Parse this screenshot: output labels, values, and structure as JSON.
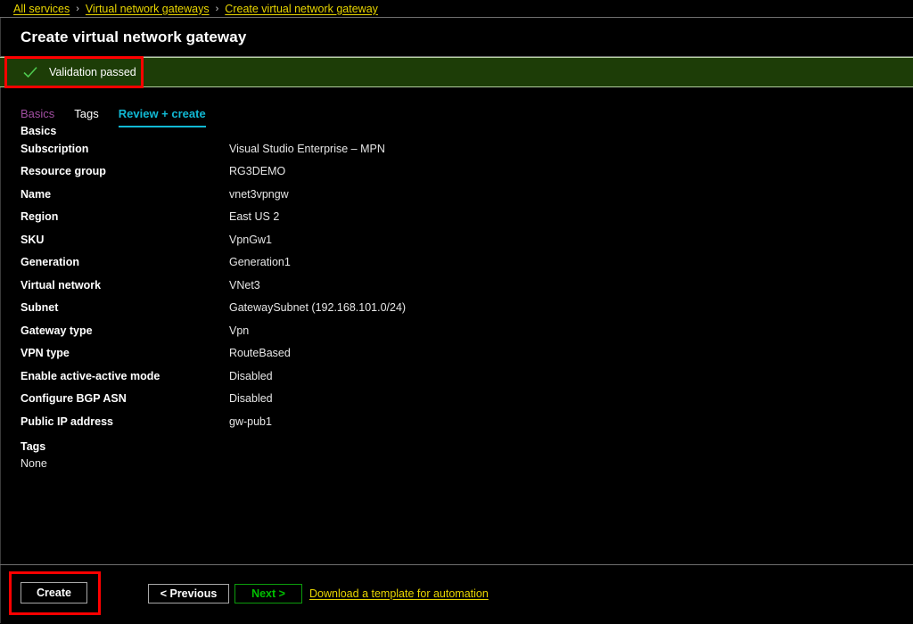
{
  "breadcrumb": {
    "separator": "›",
    "items": [
      {
        "label": "All services"
      },
      {
        "label": "Virtual network gateways"
      },
      {
        "label": "Create virtual network gateway"
      }
    ]
  },
  "header": {
    "title": "Create virtual network gateway"
  },
  "banner": {
    "icon": "checkmark-icon",
    "text": "Validation passed",
    "background_color": "#1d3d07",
    "border_color": "#b4cfa0",
    "check_color": "#4ec94e"
  },
  "tabs": [
    {
      "id": "basics",
      "label": "Basics",
      "state": "visited",
      "color": "#a14ea1"
    },
    {
      "id": "tags",
      "label": "Tags",
      "state": "normal",
      "color": "#ffffff"
    },
    {
      "id": "review-create",
      "label": "Review + create",
      "state": "active",
      "color": "#11b9d4"
    }
  ],
  "main": {
    "basics_section_title": "Basics",
    "basics_rows": [
      {
        "label": "Subscription",
        "value": "Visual Studio Enterprise – MPN"
      },
      {
        "label": "Resource group",
        "value": "RG3DEMO"
      },
      {
        "label": "Name",
        "value": "vnet3vpngw"
      },
      {
        "label": "Region",
        "value": "East US 2"
      },
      {
        "label": "SKU",
        "value": "VpnGw1"
      },
      {
        "label": "Generation",
        "value": "Generation1"
      },
      {
        "label": "Virtual network",
        "value": "VNet3"
      },
      {
        "label": "Subnet",
        "value": "GatewaySubnet (192.168.101.0/24)"
      },
      {
        "label": "Gateway type",
        "value": "Vpn"
      },
      {
        "label": "VPN type",
        "value": "RouteBased"
      },
      {
        "label": "Enable active-active mode",
        "value": "Disabled"
      },
      {
        "label": "Configure BGP ASN",
        "value": "Disabled"
      },
      {
        "label": "Public IP address",
        "value": "gw-pub1"
      }
    ],
    "tags_section_title": "Tags",
    "tags_value": "None"
  },
  "footer": {
    "create_label": "Create",
    "previous_label": "< Previous",
    "next_label": "Next >",
    "download_link_label": "Download a template for automation",
    "next_color": "#00c000",
    "link_color": "#e8d500"
  },
  "annotations": {
    "color": "#ff0000",
    "boxes": [
      {
        "target": "validation-banner-message"
      },
      {
        "target": "create-button"
      }
    ]
  }
}
